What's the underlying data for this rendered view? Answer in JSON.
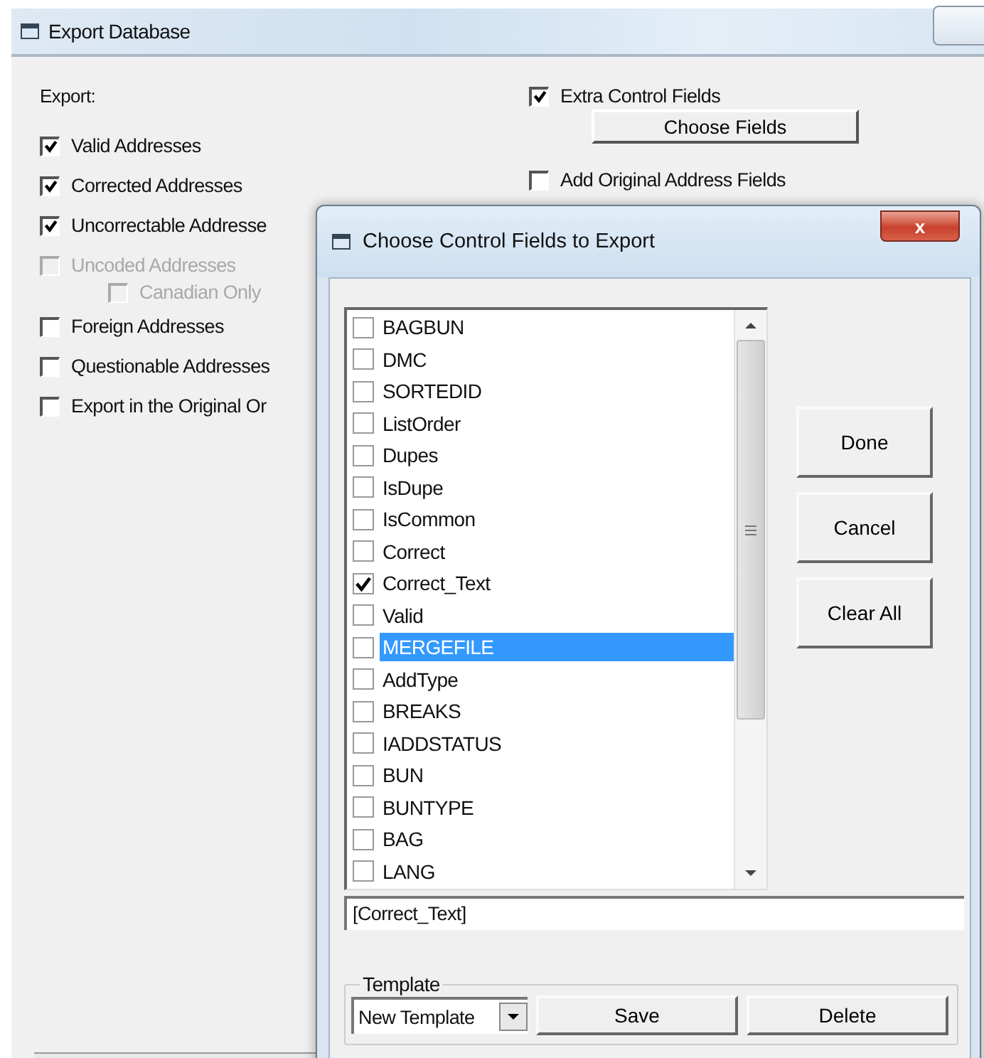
{
  "main_window": {
    "title": "Export Database",
    "export_label": "Export:",
    "options": [
      {
        "label": "Valid Addresses",
        "checked": true,
        "disabled": false
      },
      {
        "label": "Corrected Addresses",
        "checked": true,
        "disabled": false
      },
      {
        "label": "Uncorrectable Addresse",
        "checked": true,
        "disabled": false
      },
      {
        "label": "Uncoded Addresses",
        "checked": false,
        "disabled": true,
        "children": [
          {
            "label": "Canadian Only",
            "checked": false,
            "disabled": true
          }
        ]
      },
      {
        "label": "Foreign Addresses",
        "checked": false,
        "disabled": false
      },
      {
        "label": "Questionable Addresses",
        "checked": false,
        "disabled": false
      },
      {
        "label": "Export in the Original Or",
        "checked": false,
        "disabled": false
      }
    ],
    "extra_control_fields": {
      "label": "Extra Control Fields",
      "checked": true
    },
    "choose_fields_button": "Choose Fields",
    "add_original_fields": {
      "label": "Add Original Address Fields",
      "checked": false
    }
  },
  "dialog": {
    "title": "Choose Control Fields to Export",
    "close_button": "x",
    "fields": [
      {
        "label": "BAGBUN",
        "checked": false,
        "selected": false
      },
      {
        "label": "DMC",
        "checked": false,
        "selected": false
      },
      {
        "label": "SORTEDID",
        "checked": false,
        "selected": false
      },
      {
        "label": "ListOrder",
        "checked": false,
        "selected": false
      },
      {
        "label": "Dupes",
        "checked": false,
        "selected": false
      },
      {
        "label": "IsDupe",
        "checked": false,
        "selected": false
      },
      {
        "label": "IsCommon",
        "checked": false,
        "selected": false
      },
      {
        "label": "Correct",
        "checked": false,
        "selected": false
      },
      {
        "label": "Correct_Text",
        "checked": true,
        "selected": false
      },
      {
        "label": "Valid",
        "checked": false,
        "selected": false
      },
      {
        "label": "MERGEFILE",
        "checked": false,
        "selected": true
      },
      {
        "label": "AddType",
        "checked": false,
        "selected": false
      },
      {
        "label": "BREAKS",
        "checked": false,
        "selected": false
      },
      {
        "label": "IADDSTATUS",
        "checked": false,
        "selected": false
      },
      {
        "label": "BUN",
        "checked": false,
        "selected": false
      },
      {
        "label": "BUNTYPE",
        "checked": false,
        "selected": false
      },
      {
        "label": "BAG",
        "checked": false,
        "selected": false
      },
      {
        "label": "LANG",
        "checked": false,
        "selected": false
      }
    ],
    "buttons": [
      "Done",
      "Cancel",
      "Clear All"
    ],
    "selection_field": {
      "value": "[Correct_Text]"
    },
    "template": {
      "legend": "Template",
      "value": "New Template",
      "buttons": [
        "Save",
        "Delete"
      ]
    }
  }
}
